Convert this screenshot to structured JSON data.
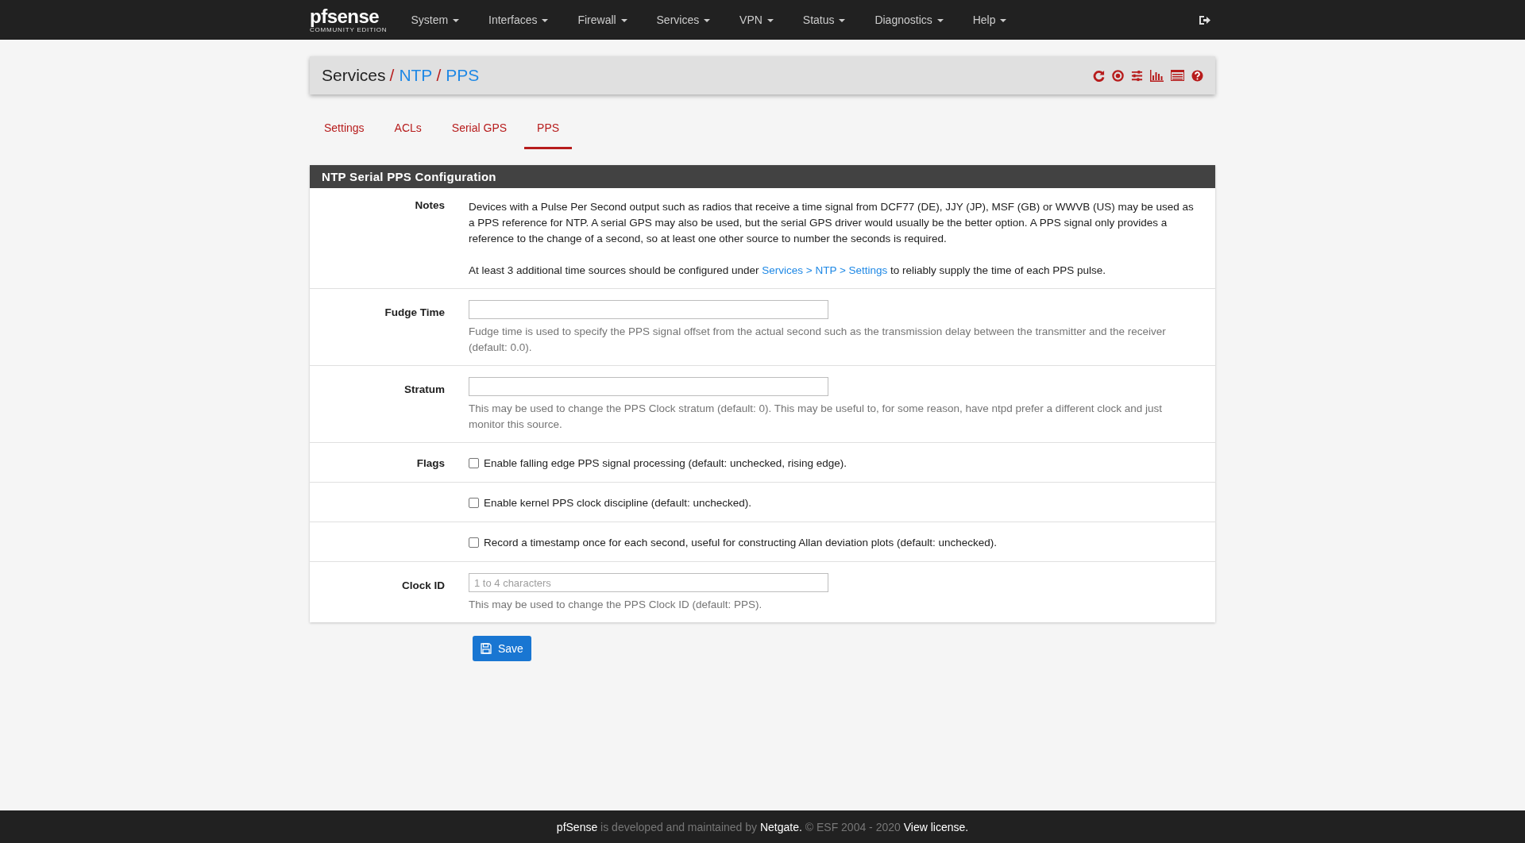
{
  "navbar": {
    "logo": {
      "brand": "pfsense",
      "subtitle": "COMMUNITY EDITION"
    },
    "menus": [
      "System",
      "Interfaces",
      "Firewall",
      "Services",
      "VPN",
      "Status",
      "Diagnostics",
      "Help"
    ]
  },
  "breadcrumb": {
    "separator": "/",
    "items": [
      {
        "label": "Services",
        "link": false
      },
      {
        "label": "NTP",
        "link": true
      },
      {
        "label": "PPS",
        "link": true
      }
    ]
  },
  "tabs": [
    {
      "label": "Settings",
      "selected": false
    },
    {
      "label": "ACLs",
      "selected": false
    },
    {
      "label": "Serial GPS",
      "selected": false
    },
    {
      "label": "PPS",
      "selected": true
    }
  ],
  "panel": {
    "title": "NTP Serial PPS Configuration",
    "notes": {
      "label": "Notes",
      "paragraph": "Devices with a Pulse Per Second output such as radios that receive a time signal from DCF77 (DE), JJY (JP), MSF (GB) or WWVB (US) may be used as a PPS reference for NTP. A serial GPS may also be used, but the serial GPS driver would usually be the better option. A PPS signal only provides a reference to the change of a second, so at least one other source to number the seconds is required.",
      "second_before": "At least 3 additional time sources should be configured under ",
      "second_link": "Services > NTP > Settings",
      "second_after": " to reliably supply the time of each PPS pulse."
    },
    "fields": [
      {
        "label": "Fudge Time",
        "help": "Fudge time is used to specify the PPS signal offset from the actual second such as the transmission delay between the transmitter and the receiver (default: 0.0)."
      },
      {
        "label": "Stratum",
        "help": "This may be used to change the PPS Clock stratum (default: 0). This may be useful to, for some reason, have ntpd prefer a different clock and just monitor this source."
      }
    ],
    "flags": {
      "label": "Flags",
      "options": [
        {
          "label": "Enable falling edge PPS signal processing (default: unchecked, rising edge).",
          "checked": false
        },
        {
          "label": "Enable kernel PPS clock discipline (default: unchecked).",
          "checked": false
        },
        {
          "label": "Record a timestamp once for each second, useful for constructing Allan deviation plots (default: unchecked).",
          "checked": false
        }
      ]
    },
    "clock_id": {
      "label": "Clock ID",
      "placeholder": "1 to 4 characters",
      "help": "This may be used to change the PPS Clock ID (default: PPS)."
    }
  },
  "save_button": "Save",
  "footer": {
    "brand": "pfSense",
    "text1": " is developed and maintained by ",
    "company": "Netgate.",
    "text2": " © ESF 2004 - 2020 ",
    "license": "View license."
  }
}
